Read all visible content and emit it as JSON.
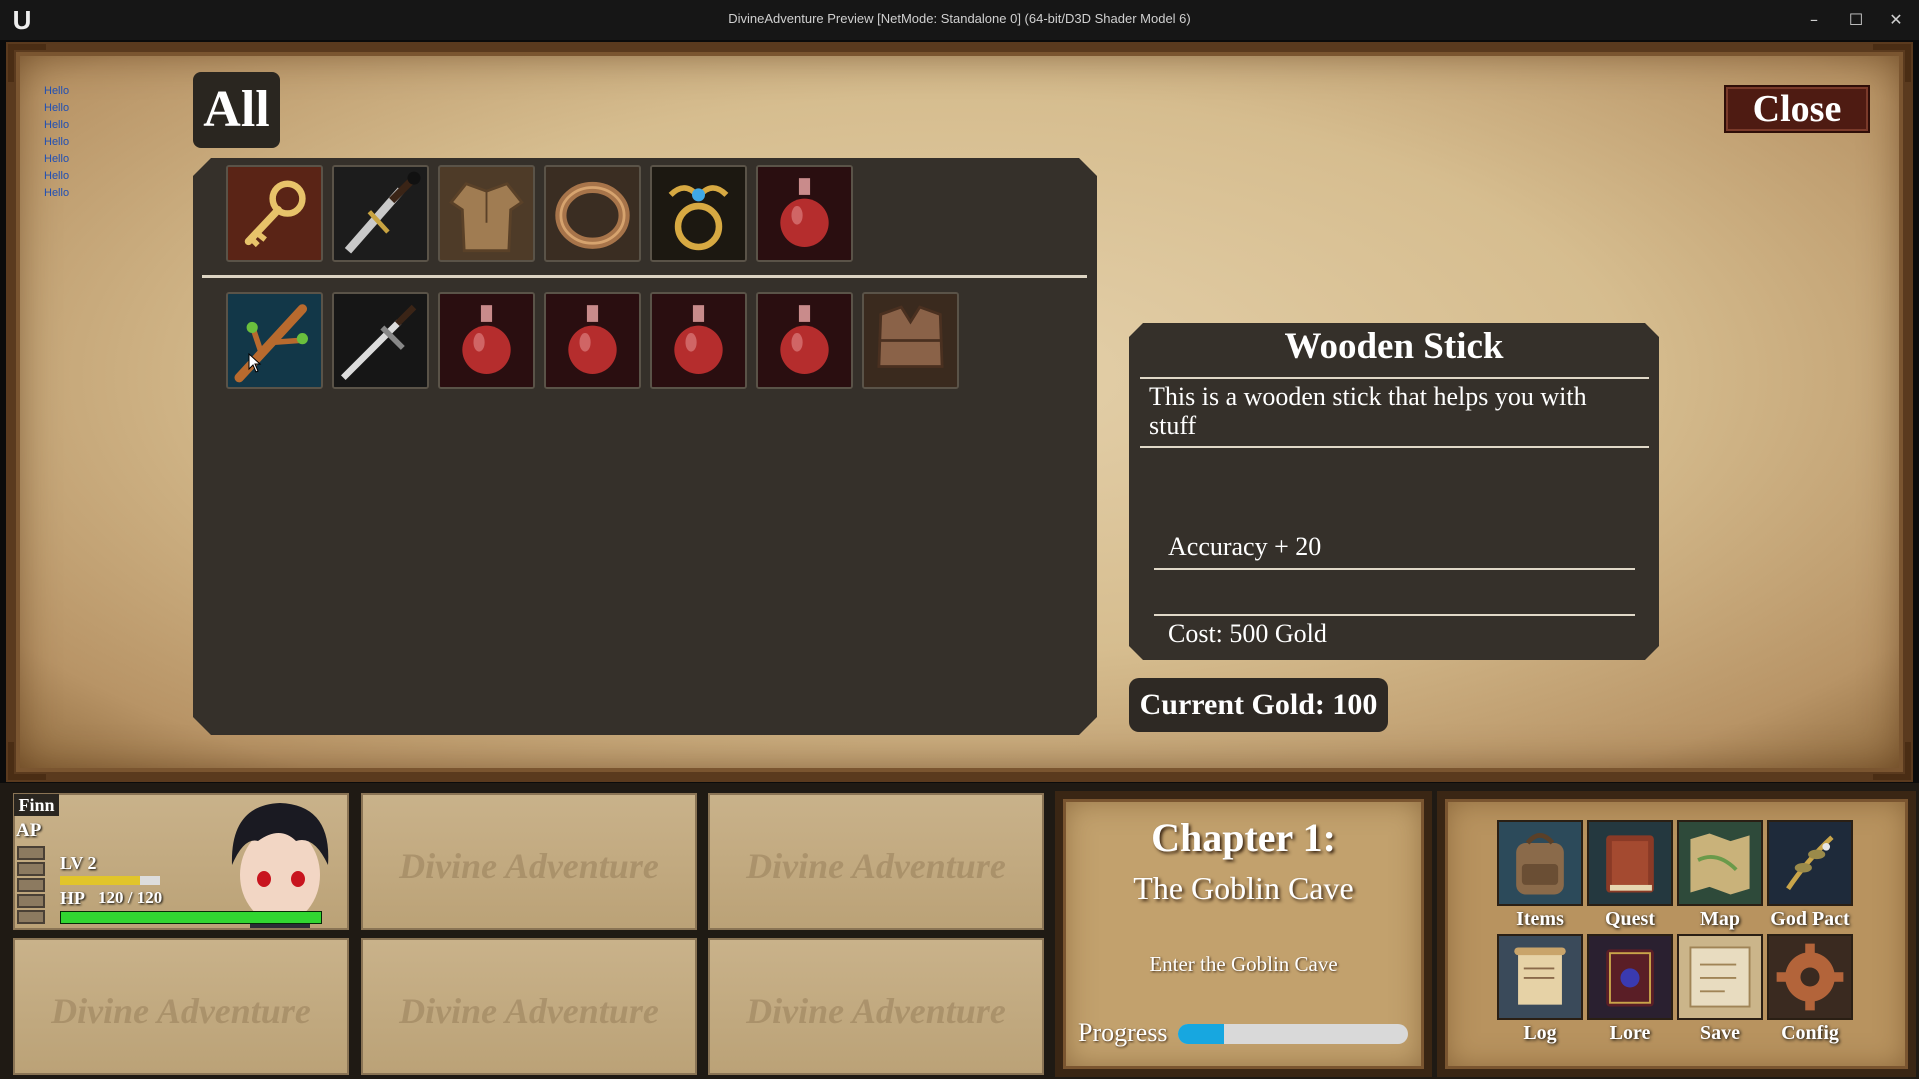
{
  "window": {
    "title": "DivineAdventure Preview [NetMode: Standalone 0]  (64-bit/D3D Shader Model 6)",
    "minimize": "–",
    "maximize": "☐",
    "close": "✕"
  },
  "debug": {
    "lines": [
      "Hello",
      "Hello",
      "Hello",
      "Hello",
      "Hello",
      "Hello",
      "Hello"
    ]
  },
  "inventory": {
    "tab_label": "All",
    "close_label": "Close",
    "equipment_row": [
      "golden-key-icon",
      "black-sword-icon",
      "leather-tunic-icon",
      "bronze-ring-icon",
      "winged-gold-ring-icon",
      "red-potion-icon"
    ],
    "item_row": [
      "wooden-stick-icon",
      "steel-sword-icon",
      "red-potion-icon",
      "red-potion-icon",
      "red-potion-icon",
      "red-potion-icon",
      "leather-armor-icon"
    ]
  },
  "detail": {
    "name": "Wooden Stick",
    "description": "This is a wooden stick that helps you with stuff",
    "stat": "Accuracy + 20",
    "cost": "Cost: 500 Gold"
  },
  "gold": {
    "label": "Current Gold: 100"
  },
  "party": {
    "member": {
      "name": "Finn",
      "ap_label": "AP",
      "level": "LV 2",
      "hp_label": "HP",
      "hp_text": "120 / 120",
      "xp_fraction": 0.8,
      "hp_fraction": 1.0
    },
    "empty_slot_watermark": "Divine Adventure"
  },
  "chapter": {
    "title": "Chapter 1:",
    "subtitle": "The Goblin Cave",
    "objective": "Enter the Goblin Cave",
    "progress_label": "Progress",
    "progress_fraction": 0.2
  },
  "menu": {
    "items": [
      {
        "label": "Items",
        "icon": "backpack-icon"
      },
      {
        "label": "Quest",
        "icon": "book-icon"
      },
      {
        "label": "Map",
        "icon": "map-icon"
      },
      {
        "label": "God Pact",
        "icon": "laurel-icon"
      },
      {
        "label": "Log",
        "icon": "scroll-icon"
      },
      {
        "label": "Lore",
        "icon": "tome-icon"
      },
      {
        "label": "Save",
        "icon": "parchment-icon"
      },
      {
        "label": "Config",
        "icon": "gear-icon"
      }
    ]
  },
  "colors": {
    "accent_blue": "#17a7e0",
    "hp_green": "#31d631",
    "xp_yellow": "#e1c52a",
    "close_red": "#4e1b12",
    "panel_dark": "#35302a"
  }
}
